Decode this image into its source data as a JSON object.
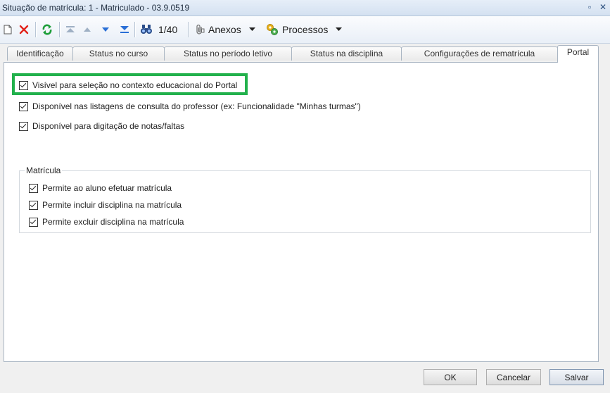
{
  "window": {
    "title": "Situação de matrícula: 1 - Matriculado - 03.9.0519",
    "restore_glyph": "▫",
    "close_glyph": "✕"
  },
  "toolbar": {
    "record_counter": "1/40",
    "anexos_label": "Anexos",
    "processos_label": "Processos"
  },
  "tabs": [
    {
      "label": "Identificação",
      "active": false
    },
    {
      "label": "Status no curso",
      "active": false
    },
    {
      "label": "Status no período letivo",
      "active": false
    },
    {
      "label": "Status na disciplina",
      "active": false
    },
    {
      "label": "Configurações de rematrícula",
      "active": false
    },
    {
      "label": "Portal",
      "active": true
    }
  ],
  "portal": {
    "options": [
      {
        "label": "Visível para seleção no contexto educacional do Portal",
        "checked": true
      },
      {
        "label": "Disponível nas listagens de consulta do professor (ex: Funcionalidade \"Minhas turmas\")",
        "checked": true
      },
      {
        "label": "Disponível para digitação de notas/faltas",
        "checked": true
      }
    ],
    "matricula_group": {
      "legend": "Matrícula",
      "options": [
        {
          "label": "Permite ao aluno efetuar matrícula",
          "checked": true
        },
        {
          "label": "Permite incluir disciplina na matrícula",
          "checked": true
        },
        {
          "label": "Permite excluir disciplina na matrícula",
          "checked": true
        }
      ]
    }
  },
  "footer": {
    "ok_label": "OK",
    "cancel_label": "Cancelar",
    "save_label": "Salvar"
  },
  "colors": {
    "highlight": "#22b14c",
    "delete_icon": "#e2231a",
    "refresh_icon": "#1e9e3a",
    "nav_icon": "#2a6fd6"
  }
}
